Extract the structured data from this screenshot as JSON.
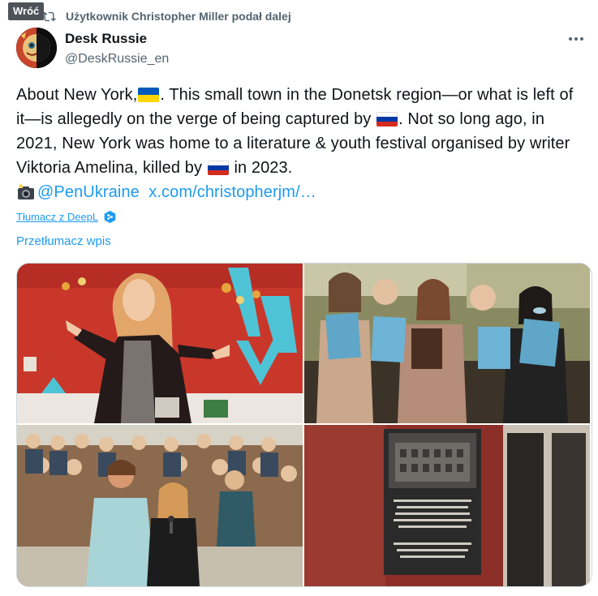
{
  "tooltip": {
    "back": "Wróć"
  },
  "repost": {
    "text": "Użytkownik Christopher Miller podał dalej"
  },
  "author": {
    "name": "Desk Russie",
    "handle": "@DeskRussie_en"
  },
  "tweet": {
    "p1": "About New York,",
    "p2": ". This small town in the Donetsk region—or what is left of it—is allegedly on the verge of being captured by",
    "p3": ". Not so long ago, in 2021, New York was home to a literature & youth festival organised by writer Viktoria Amelina, killed by",
    "p4": " in 2023.",
    "mention": "@PenUkraine",
    "url": "x.com/christopherjm/…"
  },
  "deepl": {
    "label": "Tłumacz z DeepL"
  },
  "translate": {
    "label": "Przetłumacz wpis"
  },
  "icons": {
    "repost": "repost-icon",
    "more": "more-icon",
    "flag_ukraine": "flag-ukraine-icon",
    "flag_russia": "flag-russia-icon",
    "camera": "camera-flash-icon",
    "deepl": "deepl-icon"
  },
  "colors": {
    "link": "#1d9bf0",
    "muted": "#536471",
    "text": "#0f1419"
  }
}
